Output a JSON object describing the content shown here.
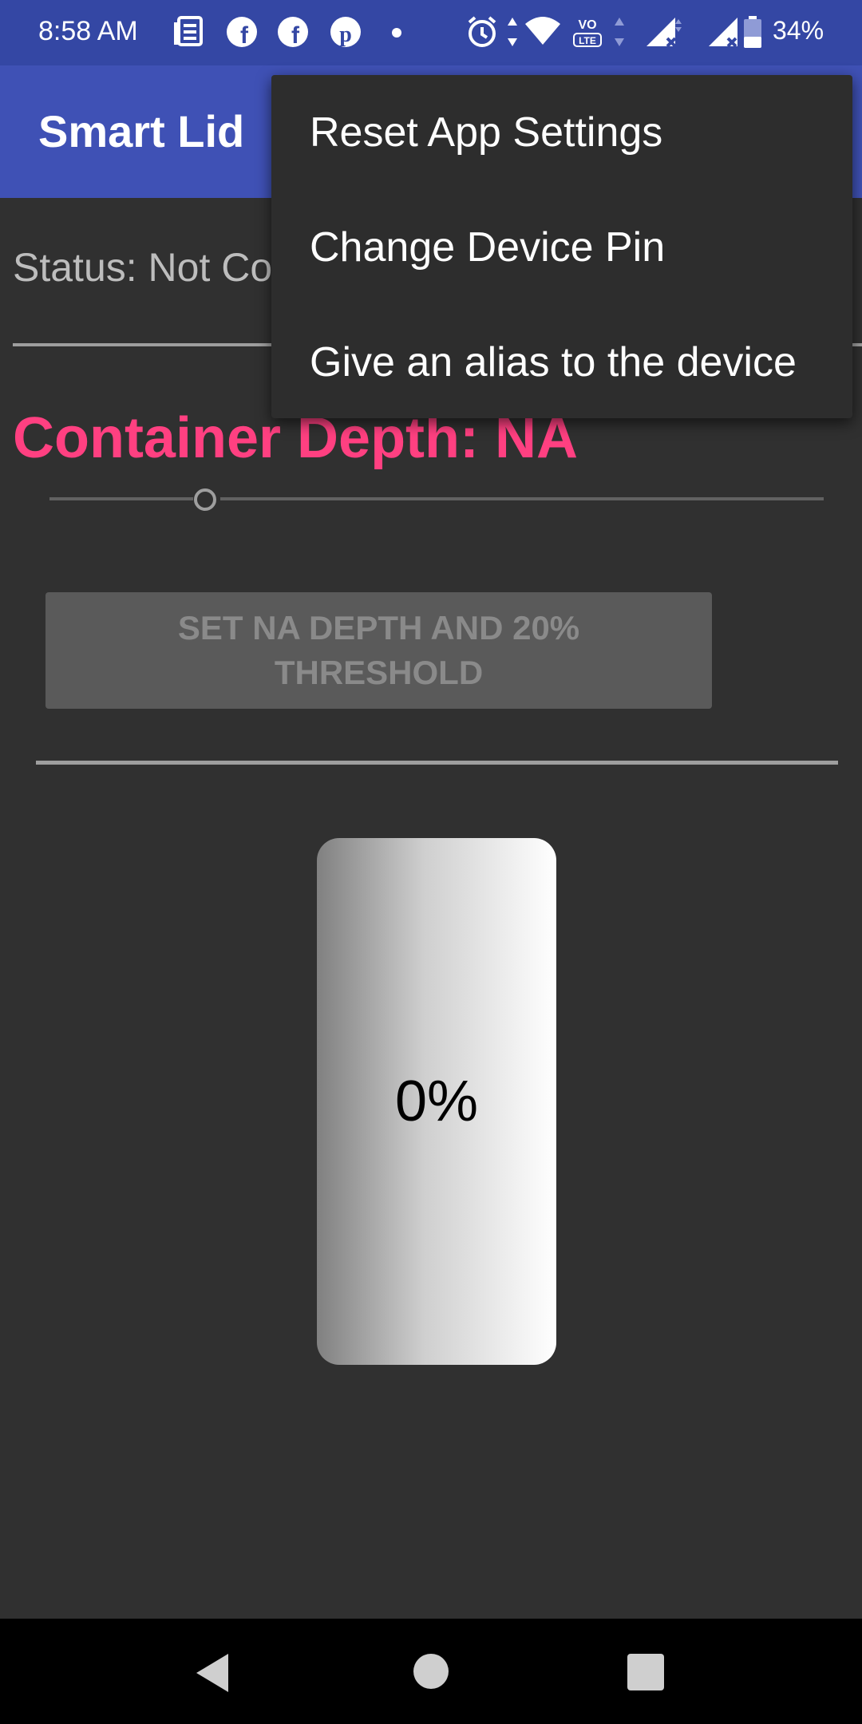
{
  "status_bar": {
    "time": "8:58 AM",
    "battery": "34%",
    "icons": [
      "news-icon",
      "facebook-icon",
      "facebook-icon",
      "pinterest-icon",
      "dot-icon",
      "alarm-icon",
      "data-arrows-icon",
      "wifi-icon",
      "volte-icon",
      "signal-icon",
      "signal-icon",
      "battery-icon"
    ],
    "volte_label": "VO LTE"
  },
  "app_bar": {
    "title": "Smart Lid"
  },
  "content": {
    "status_text": "Status: Not Co",
    "depth_title": "Container Depth: NA",
    "set_button_label": "SET NA DEPTH AND 20% THRESHOLD",
    "level_percent_text": "0%",
    "slider_value_fraction": 0.2
  },
  "menu": {
    "items": [
      {
        "label": "Reset App Settings"
      },
      {
        "label": "Change Device Pin"
      },
      {
        "label": "Give an alias to the device"
      }
    ]
  },
  "colors": {
    "status_bar": "#3447a4",
    "app_bar": "#3f51b5",
    "background": "#303030",
    "accent": "#ff4081",
    "menu_bg": "#2d2d2d"
  }
}
